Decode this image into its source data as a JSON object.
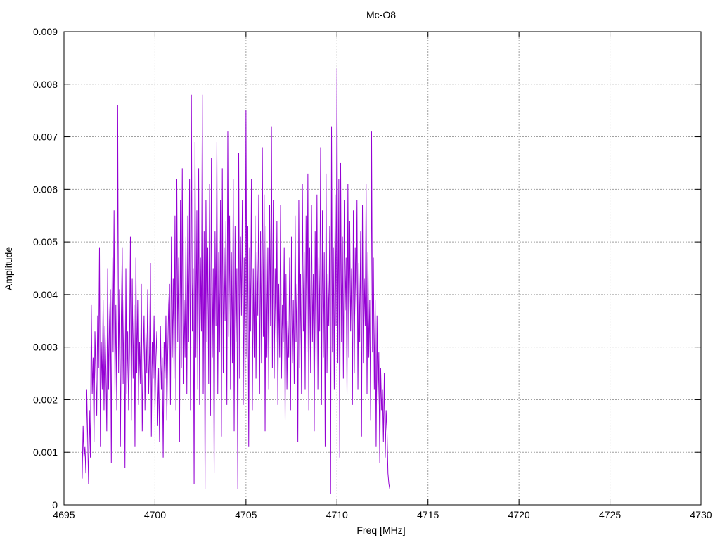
{
  "chart_data": {
    "type": "line",
    "title": "Mc-O8",
    "xlabel": "Freq [MHz]",
    "ylabel": "Amplitude",
    "xlim": [
      4695,
      4730
    ],
    "ylim": [
      0,
      0.009
    ],
    "x_ticks": [
      4695,
      4700,
      4705,
      4710,
      4715,
      4720,
      4725,
      4730
    ],
    "x_tick_labels": [
      "4695",
      "4700",
      "4705",
      "4710",
      "4715",
      "4720",
      "4725",
      "4730"
    ],
    "y_ticks": [
      0,
      0.001,
      0.002,
      0.003,
      0.004,
      0.005,
      0.006,
      0.007,
      0.008,
      0.009
    ],
    "y_tick_labels": [
      "0",
      "0.001",
      "0.002",
      "0.003",
      "0.004",
      "0.005",
      "0.006",
      "0.007",
      "0.008",
      "0.009"
    ],
    "grid": true,
    "series": [
      {
        "color": "#9400d3",
        "x_start": 4696.0,
        "x_step": 0.05,
        "values": [
          0.0005,
          0.0015,
          0.0009,
          0.0011,
          0.0006,
          0.0022,
          0.0013,
          0.0004,
          0.0018,
          0.0009,
          0.0038,
          0.0021,
          0.0028,
          0.0012,
          0.0033,
          0.0025,
          0.0017,
          0.0036,
          0.0026,
          0.0049,
          0.0011,
          0.0031,
          0.0022,
          0.0039,
          0.0018,
          0.0034,
          0.0026,
          0.0014,
          0.0045,
          0.0022,
          0.0035,
          0.0041,
          0.0008,
          0.0047,
          0.0029,
          0.0056,
          0.0021,
          0.0038,
          0.0018,
          0.0076,
          0.0025,
          0.0041,
          0.0011,
          0.0036,
          0.0049,
          0.0023,
          0.0039,
          0.0007,
          0.0045,
          0.0021,
          0.0033,
          0.0018,
          0.0029,
          0.0051,
          0.0016,
          0.0043,
          0.0024,
          0.0038,
          0.0011,
          0.0047,
          0.0025,
          0.0039,
          0.0019,
          0.0031,
          0.0023,
          0.0042,
          0.0014,
          0.0027,
          0.0036,
          0.0018,
          0.0033,
          0.0025,
          0.0041,
          0.0021,
          0.0029,
          0.0046,
          0.0013,
          0.0031,
          0.0024,
          0.0036,
          0.0018,
          0.0028,
          0.0033,
          0.0015,
          0.0026,
          0.0012,
          0.0034,
          0.0022,
          0.0028,
          0.0009,
          0.0031,
          0.0024,
          0.0036,
          0.0016,
          0.0029,
          0.0038,
          0.0042,
          0.0019,
          0.0051,
          0.0028,
          0.0043,
          0.0024,
          0.0055,
          0.0018,
          0.0062,
          0.0031,
          0.0047,
          0.0012,
          0.0058,
          0.0026,
          0.0064,
          0.0023,
          0.0039,
          0.0028,
          0.0051,
          0.0021,
          0.0055,
          0.0031,
          0.0062,
          0.0018,
          0.0078,
          0.0033,
          0.0045,
          0.0004,
          0.0069,
          0.0028,
          0.0056,
          0.0022,
          0.0064,
          0.0019,
          0.0047,
          0.0033,
          0.0078,
          0.0021,
          0.0052,
          0.0003,
          0.0058,
          0.0031,
          0.0049,
          0.0023,
          0.0061,
          0.0017,
          0.0066,
          0.0028,
          0.0045,
          0.0006,
          0.0052,
          0.0034,
          0.0069,
          0.0021,
          0.0048,
          0.0029,
          0.0058,
          0.0013,
          0.0064,
          0.0025,
          0.0049,
          0.0035,
          0.0054,
          0.0019,
          0.0071,
          0.0032,
          0.0055,
          0.0022,
          0.0048,
          0.0027,
          0.0062,
          0.0014,
          0.0053,
          0.0031,
          0.0045,
          0.0003,
          0.0067,
          0.0024,
          0.0051,
          0.0036,
          0.0058,
          0.0019,
          0.0047,
          0.0022,
          0.0075,
          0.0028,
          0.0053,
          0.0011,
          0.0049,
          0.0033,
          0.0062,
          0.0018,
          0.0045,
          0.0028,
          0.0055,
          0.0024,
          0.0048,
          0.0036,
          0.0059,
          0.0021,
          0.0052,
          0.0027,
          0.0068,
          0.0032,
          0.0059,
          0.0014,
          0.0053,
          0.0028,
          0.0049,
          0.0022,
          0.0057,
          0.0034,
          0.0072,
          0.0026,
          0.0058,
          0.0024,
          0.0045,
          0.0031,
          0.0054,
          0.0019,
          0.0042,
          0.0028,
          0.0057,
          0.0024,
          0.0038,
          0.0031,
          0.0049,
          0.0016,
          0.0044,
          0.0022,
          0.0035,
          0.0028,
          0.0047,
          0.0018,
          0.0051,
          0.0027,
          0.0039,
          0.0023,
          0.0055,
          0.0031,
          0.0042,
          0.0012,
          0.0058,
          0.0026,
          0.0044,
          0.0021,
          0.0061,
          0.0033,
          0.0048,
          0.0022,
          0.0055,
          0.0029,
          0.0063,
          0.0018,
          0.0049,
          0.0025,
          0.0057,
          0.0031,
          0.0044,
          0.0014,
          0.0052,
          0.0026,
          0.0059,
          0.0022,
          0.0047,
          0.0033,
          0.0068,
          0.0019,
          0.0056,
          0.0028,
          0.0048,
          0.0011,
          0.0063,
          0.0025,
          0.0044,
          0.0034,
          0.0053,
          0.0002,
          0.0072,
          0.0029,
          0.0049,
          0.0022,
          0.0059,
          0.0034,
          0.0083,
          0.0027,
          0.0062,
          0.0009,
          0.0065,
          0.0031,
          0.0051,
          0.0024,
          0.0058,
          0.0037,
          0.0047,
          0.0021,
          0.0061,
          0.0028,
          0.0054,
          0.0033,
          0.0045,
          0.0019,
          0.0056,
          0.0025,
          0.0049,
          0.0036,
          0.0058,
          0.0022,
          0.0046,
          0.0031,
          0.0052,
          0.0013,
          0.0057,
          0.0027,
          0.0043,
          0.0034,
          0.0061,
          0.0021,
          0.0048,
          0.0028,
          0.0039,
          0.0016,
          0.0071,
          0.0029,
          0.0047,
          0.0022,
          0.0039,
          0.0011,
          0.0036,
          0.0019,
          0.0029,
          0.0008,
          0.0026,
          0.0018,
          0.0022,
          0.0012,
          0.0025,
          0.0009,
          0.0018,
          0.0014,
          0.0006,
          0.0004,
          0.0003
        ]
      }
    ]
  }
}
